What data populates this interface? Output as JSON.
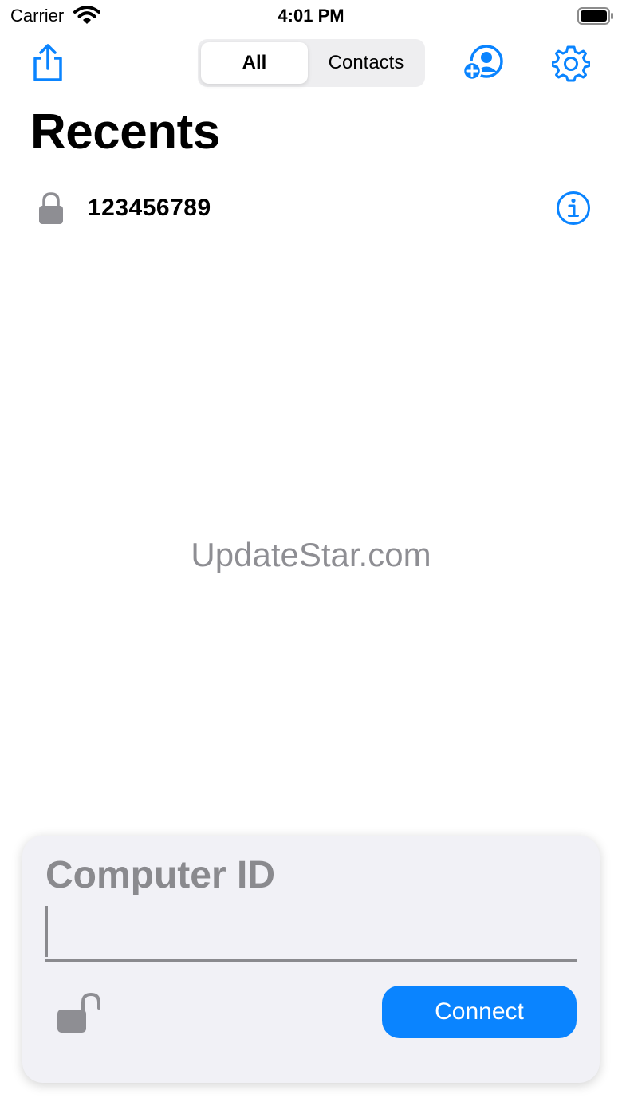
{
  "status_bar": {
    "carrier": "Carrier",
    "time": "4:01 PM",
    "icons": [
      "wifi-icon",
      "battery-icon"
    ]
  },
  "nav": {
    "share_icon": "share-icon",
    "segments": [
      {
        "label": "All",
        "selected": true
      },
      {
        "label": "Contacts",
        "selected": false
      }
    ],
    "add_contact_icon": "add-contact-icon",
    "settings_icon": "gear-icon"
  },
  "title": "Recents",
  "recents": [
    {
      "id": "123456789",
      "icon": "lock-icon",
      "action_icon": "info-icon"
    }
  ],
  "watermark": "UpdateStar.com",
  "connect_panel": {
    "title": "Computer ID",
    "input_value": "",
    "input_placeholder": "",
    "lock_icon": "unlock-icon",
    "button_label": "Connect"
  },
  "colors": {
    "accent": "#0a84ff",
    "secondary_text": "#8a8a8e",
    "panel_bg": "#f1f1f6",
    "segment_bg": "#eeeef0"
  }
}
